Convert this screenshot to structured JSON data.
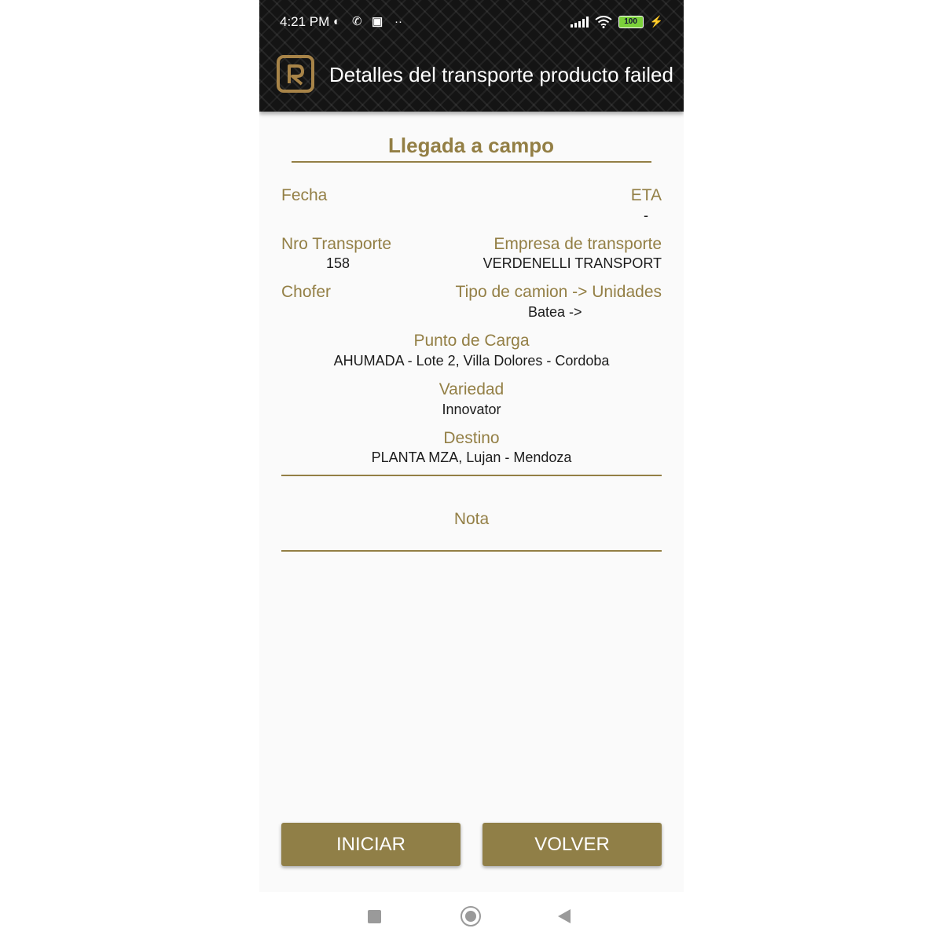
{
  "status_bar": {
    "time": "4:21 PM",
    "battery": "100",
    "icons": [
      "app-icon",
      "whatsapp-icon",
      "linkedin-icon",
      "more-dots-icon",
      "signal-icon",
      "wifi-icon",
      "battery-icon",
      "charging-icon"
    ]
  },
  "header": {
    "title": "Detalles del transporte producto failed"
  },
  "section": {
    "title": "Llegada a campo"
  },
  "fields": {
    "fecha_label": "Fecha",
    "eta_label": "ETA",
    "eta_value": "-",
    "nro_label": "Nro Transporte",
    "nro_value": "158",
    "empresa_label": "Empresa de transporte",
    "empresa_value": "VERDENELLI TRANSPORT",
    "chofer_label": "Chofer",
    "tipo_label": "Tipo de camion -> Unidades",
    "tipo_value": "Batea ->",
    "punto_label": "Punto de Carga",
    "punto_value": "AHUMADA - Lote 2, Villa Dolores - Cordoba",
    "variedad_label": "Variedad",
    "variedad_value": "Innovator",
    "destino_label": "Destino",
    "destino_value": "PLANTA MZA, Lujan - Mendoza",
    "nota_label": "Nota"
  },
  "buttons": {
    "start": "INICIAR",
    "back": "VOLVER"
  },
  "colors": {
    "accent": "#937f45",
    "button": "#907f47",
    "header_bg": "#141414"
  }
}
